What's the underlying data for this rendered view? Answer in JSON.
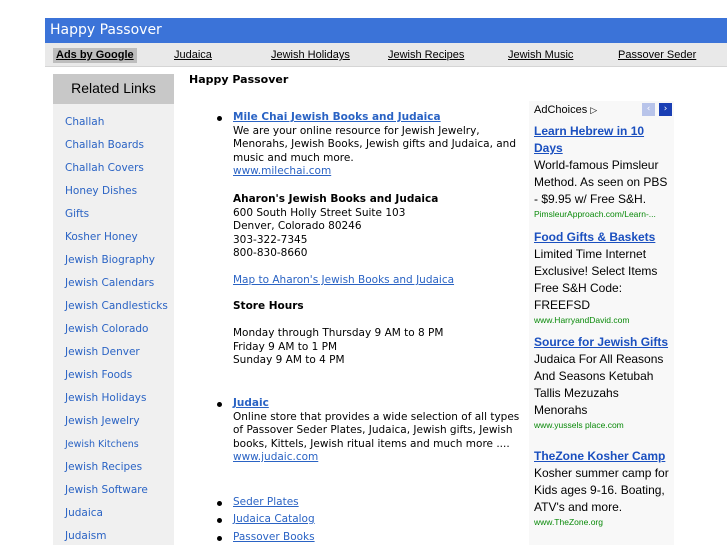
{
  "header": {
    "title": "Happy Passover"
  },
  "nav": {
    "ads_label": "Ads by Google",
    "links": [
      "Judaica",
      "Jewish Holidays",
      "Jewish Recipes",
      "Jewish Music",
      "Passover Seder"
    ]
  },
  "sidebar": {
    "header": "Related Links",
    "items": [
      "Challah",
      "Challah Boards",
      "Challah Covers",
      "Honey Dishes",
      "Gifts",
      "Kosher Honey",
      "Jewish Biography",
      "Jewish Calendars",
      "Jewish Candlesticks",
      "Jewish Colorado",
      "Jewish Denver",
      "Jewish Foods",
      "Jewish Holidays",
      "Jewish Jewelry",
      "Jewish Kitchens",
      "Jewish Recipes",
      "Jewish Software",
      "Judaica",
      "Judaism"
    ]
  },
  "main": {
    "title": "Happy Passover",
    "listing1": {
      "name": "Mile Chai Jewish Books and Judaica",
      "description": "We are your online resource for Jewish Jewelry, Menorahs, Jewish Books, Jewish gifts and Judaica, and music and much more.",
      "url": "www.milechai.com",
      "store_name": "Aharon's Jewish Books and Judaica",
      "address1": "600 South Holly Street Suite 103",
      "address2": "Denver, Colorado 80246",
      "phone1": "303-322-7345",
      "phone2": "800-830-8660",
      "map_link": "Map to Aharon's Jewish Books and Judaica",
      "hours_title": "Store Hours",
      "hours1": "Monday through Thursday 9 AM to 8 PM",
      "hours2": "Friday 9 AM to 1 PM",
      "hours3": "Sunday 9 AM to 4 PM"
    },
    "listing2": {
      "name": "Judaic",
      "description": "Online store that provides a wide selection of all types of Passover Seder Plates, Judaica, Jewish gifts, Jewish books, Kittels, Jewish ritual items and much more ....",
      "url": "www.judaic.com"
    },
    "links": [
      "Seder Plates",
      "Judaica Catalog",
      "Passover Books"
    ]
  },
  "ads": {
    "choices_label": "AdChoices",
    "choices_icon": "▷",
    "prev_icon": "‹",
    "next_icon": "›",
    "items": [
      {
        "head": "Learn Hebrew in 10 Days",
        "body": "World-famous Pimsleur Method. As seen on PBS - $9.95 w/ Free S&H.",
        "url": "PimsleurApproach.com/Learn-..."
      },
      {
        "head": "Food Gifts & Baskets",
        "body": "Limited Time Internet Exclusive! Select Items Free S&H Code: FREEFSD",
        "url": "www.HarryandDavid.com"
      },
      {
        "head": "Source for Jewish Gifts",
        "body": "Judaica For All Reasons And Seasons Ketubah Tallis Mezuzahs Menorahs",
        "url": "www.yussels place.com"
      },
      {
        "head": "TheZone Kosher Camp",
        "body": "Kosher summer camp for Kids ages 9-16. Boating, ATV's and more.",
        "url": "www.TheZone.org"
      }
    ]
  }
}
